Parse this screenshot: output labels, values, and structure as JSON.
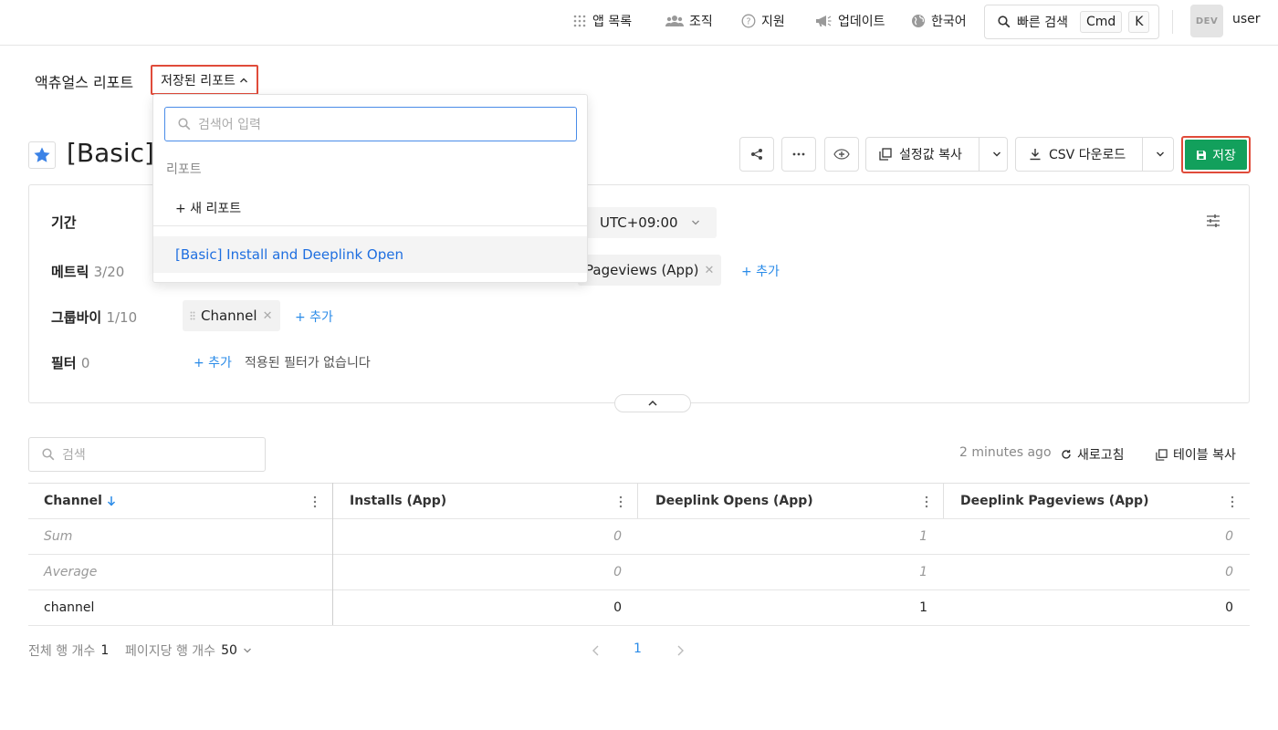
{
  "topbar": {
    "app_list": "앱 목록",
    "org": "조직",
    "support": "지원",
    "updates": "업데이트",
    "language": "한국어",
    "quick_search": "빠른 검색",
    "kbd_cmd": "Cmd",
    "kbd_k": "K",
    "avatar_badge": "DEV",
    "username": "user"
  },
  "breadcrumb": {
    "title": "액츄얼스 리포트",
    "saved_reports": "저장된 리포트"
  },
  "report": {
    "title": "[Basic]",
    "copy_settings": "설정값 복사",
    "csv_download": "CSV 다운로드",
    "save": "저장"
  },
  "config": {
    "period_label": "기간",
    "timezone": "UTC+09:00",
    "metrics_label": "메트릭",
    "metrics_count": "3/20",
    "metric_chip": "Pageviews (App)",
    "groupby_label": "그룹바이",
    "groupby_count": "1/10",
    "groupby_chip": "Channel",
    "filter_label": "필터",
    "filter_count": "0",
    "add": "+ 추가",
    "no_filter": "적용된 필터가 없습니다"
  },
  "table_toolbar": {
    "search_placeholder": "검색",
    "updated": "2 minutes ago",
    "refresh": "새로고침",
    "copy_table": "테이블 복사"
  },
  "table": {
    "columns": [
      "Channel",
      "Installs (App)",
      "Deeplink Opens (App)",
      "Deeplink Pageviews (App)"
    ],
    "rows": [
      {
        "label": "Sum",
        "values": [
          "0",
          "1",
          "0"
        ]
      },
      {
        "label": "Average",
        "values": [
          "0",
          "1",
          "0"
        ]
      },
      {
        "label": "channel",
        "values": [
          "0",
          "1",
          "0"
        ]
      }
    ]
  },
  "pagination": {
    "total_rows_label": "전체 행 개수",
    "total_rows": "1",
    "per_page_label": "페이지당 행 개수",
    "per_page": "50",
    "current_page": "1"
  },
  "dropdown": {
    "search_placeholder": "검색어 입력",
    "section": "리포트",
    "new_report": "+ 새 리포트",
    "item": "[Basic] Install and Deeplink Open"
  },
  "colors": {
    "accent_blue": "#2a8be8",
    "save_green": "#12a05c",
    "highlight_red": "#e04b3a"
  }
}
